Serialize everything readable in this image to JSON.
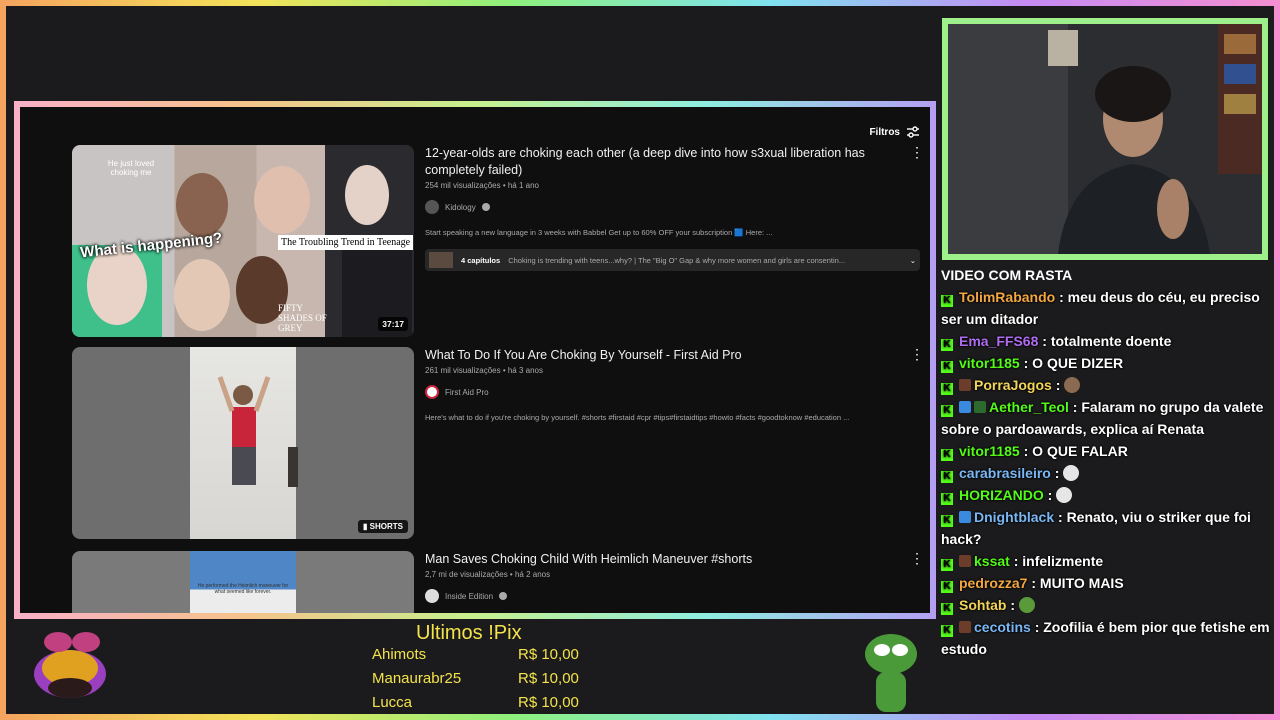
{
  "youtube": {
    "filters_label": "Filtros",
    "results": [
      {
        "title": "12-year-olds are choking each other (a deep dive into how s3xual liberation has completely failed)",
        "meta": "254 mil visualizações • há 1 ano",
        "channel": "Kidology",
        "description": "Start speaking a new language in 3 weeks with Babbel Get up to 60% OFF your subscription 🟦 Here: ...",
        "chapters_label": "4 capítulos",
        "chapters_text": "Choking is trending with teens...why? | The \"Big O\" Gap & why more women and girls are consentin...",
        "duration": "37:17",
        "thumb_texts": {
          "tl": "He just loved choking me",
          "what": "What is happening?",
          "trend": "The Troubling Trend in Teenage",
          "fifty": "FIFTY SHADES OF GREY"
        }
      },
      {
        "title": "What To Do If You Are Choking By Yourself - First Aid Pro",
        "meta": "261 mil visualizações • há 3 anos",
        "channel": "First Aid Pro",
        "description": "Here's what to do if you're choking by yourself. #shorts #firstaid #cpr #tips#firstaidtips #howto #facts #goodtoknow #education ...",
        "badge": "SHORTS"
      },
      {
        "title": "Man Saves Choking Child With Heimlich Maneuver #shorts",
        "meta": "2,7 mi de visualizações • há 2 anos",
        "channel": "Inside Edition",
        "thumb_caption": "He performed the Heimlich maneuver for what seemed like forever."
      }
    ]
  },
  "chat": {
    "header": "VIDEO COM RASTA",
    "messages": [
      {
        "user": "TolimRabando",
        "color": "#f2a742",
        "text": ": meu deus do céu, eu preciso ser um ditador"
      },
      {
        "user": "Ema_FFS68",
        "color": "#b06cf0",
        "text": ": totalmente doente"
      },
      {
        "user": "vitor1185",
        "color": "#53fc18",
        "text": ": O QUE DIZER"
      },
      {
        "user": "PorraJogos",
        "color": "#f2d45a",
        "text": ":"
      },
      {
        "user": "Aether_Teol",
        "color": "#53fc18",
        "text": ": Falaram no grupo da valete sobre o pardoawards, explica aí Renata"
      },
      {
        "user": "vitor1185",
        "color": "#53fc18",
        "text": ": O QUE FALAR"
      },
      {
        "user": "carabrasileiro",
        "color": "#7ab8f5",
        "text": ":"
      },
      {
        "user": "HORIZANDO",
        "color": "#53fc18",
        "text": ":"
      },
      {
        "user": "Dnightblack",
        "color": "#7ab8f5",
        "text": ": Renato, viu o striker que foi hack?"
      },
      {
        "user": "kssat",
        "color": "#53fc18",
        "text": ": infelizmente"
      },
      {
        "user": "pedrozza7",
        "color": "#f2a742",
        "text": ": MUITO MAIS"
      },
      {
        "user": "Sohtab",
        "color": "#f2d45a",
        "text": ":"
      },
      {
        "user": "cecotins",
        "color": "#7ab8f5",
        "text": ": Zoofilia é bem pior que fetishe em estudo"
      }
    ]
  },
  "pix": {
    "title": "Ultimos !Pix",
    "rows": [
      {
        "name": "Ahimots",
        "value": "R$ 10,00"
      },
      {
        "name": "Manaurabr25",
        "value": "R$ 10,00"
      },
      {
        "name": "Lucca",
        "value": "R$ 10,00"
      }
    ]
  }
}
